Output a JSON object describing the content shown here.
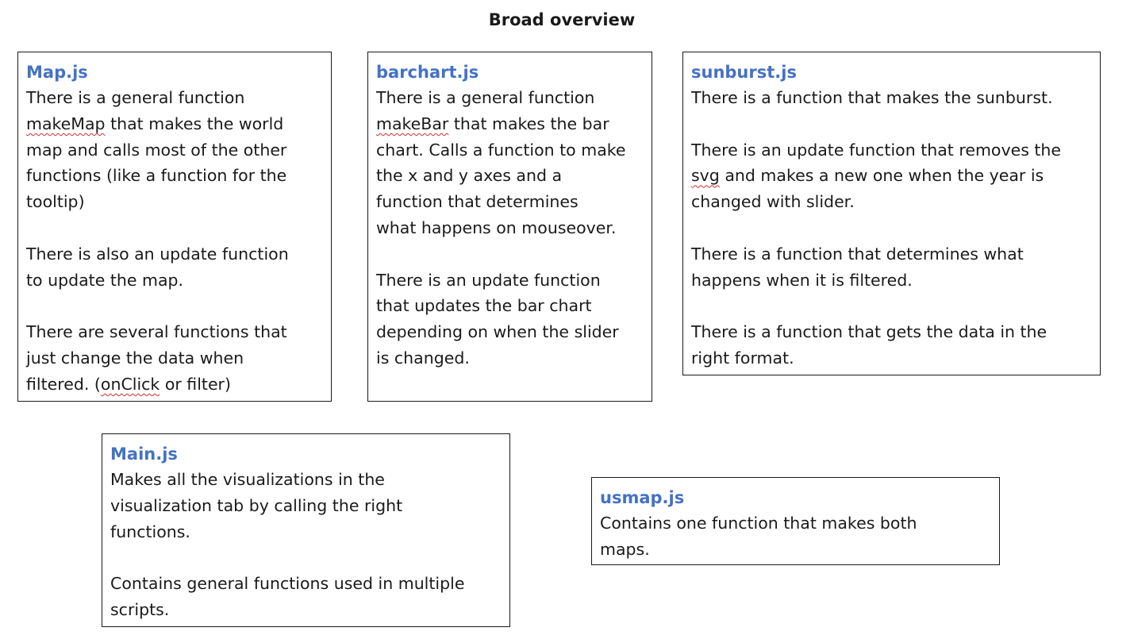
{
  "title": "Broad overview",
  "boxes": {
    "map": {
      "title": "Map.js",
      "paragraphs": [
        [
          {
            "text": "There is a general function\n"
          },
          {
            "text": "makeMap",
            "misspelled": true
          },
          {
            "text": " that makes the world\nmap and calls most of the other\nfunctions (like a function for the\ntooltip)"
          }
        ],
        [
          {
            "text": "There is also an update function\nto update the map."
          }
        ],
        [
          {
            "text": "There are several functions that\njust change the data when\nfiltered. ("
          },
          {
            "text": "onClick",
            "misspelled": true
          },
          {
            "text": " or filter)"
          }
        ]
      ]
    },
    "barchart": {
      "title": "barchart.js",
      "paragraphs": [
        [
          {
            "text": "There is a general function\n"
          },
          {
            "text": "makeBar",
            "misspelled": true
          },
          {
            "text": " that makes the bar\nchart. Calls a function to make\nthe x and y axes and a\nfunction that determines\nwhat happens on mouseover."
          }
        ],
        [
          {
            "text": "There is an update function\nthat updates the bar chart\ndepending on when the slider\nis changed."
          }
        ]
      ]
    },
    "sunburst": {
      "title": "sunburst.js",
      "paragraphs": [
        [
          {
            "text": "There is a function that makes the sunburst."
          }
        ],
        [
          {
            "text": "There is an update function that removes the\n"
          },
          {
            "text": "svg",
            "misspelled": true
          },
          {
            "text": " and makes a new one when the year is\nchanged with slider."
          }
        ],
        [
          {
            "text": "There is a function that determines what\nhappens when it is filtered."
          }
        ],
        [
          {
            "text": "There is a function that gets the data in the\nright format."
          }
        ]
      ]
    },
    "main": {
      "title": "Main.js",
      "paragraphs": [
        [
          {
            "text": "Makes all the visualizations in the\nvisualization tab by calling the right\nfunctions."
          }
        ],
        [
          {
            "text": "Contains general functions used in multiple\nscripts."
          }
        ]
      ]
    },
    "usmap": {
      "title": "usmap.js",
      "paragraphs": [
        [
          {
            "text": "Contains one function that makes both\nmaps."
          }
        ]
      ]
    }
  }
}
